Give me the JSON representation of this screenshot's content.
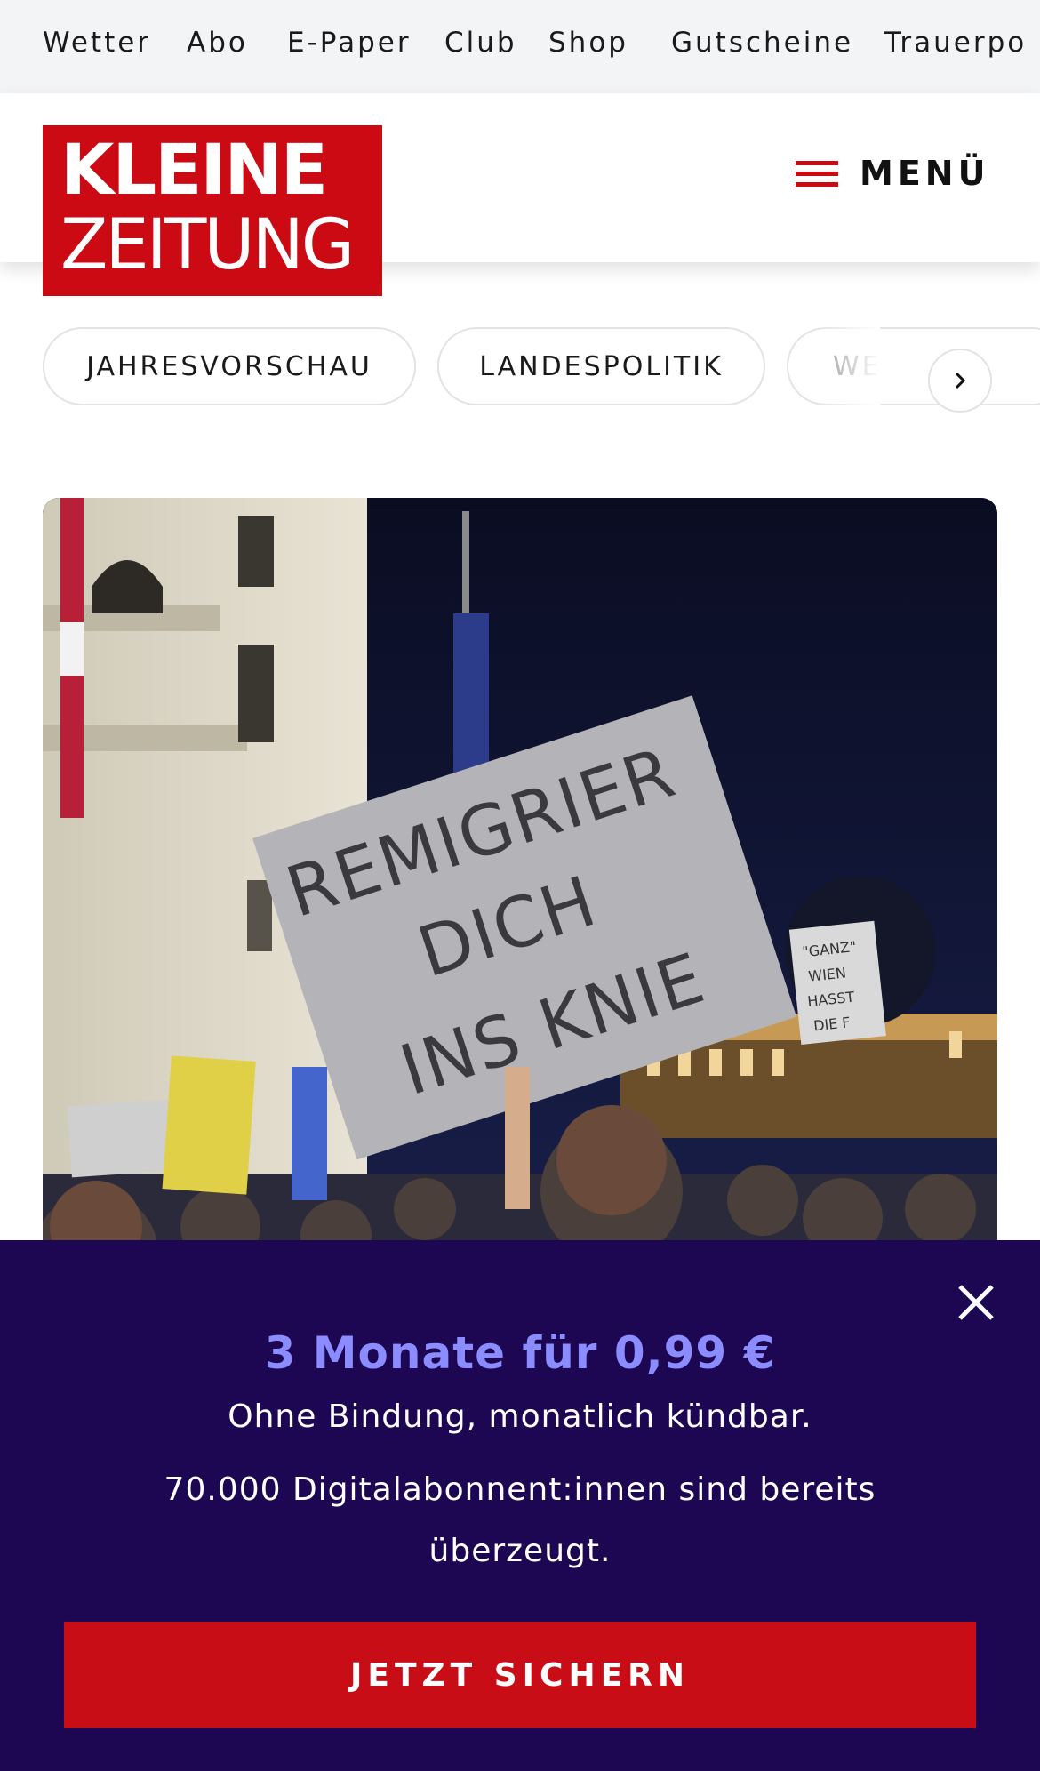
{
  "topbar": {
    "items": [
      {
        "label": "Wetter"
      },
      {
        "label": "Abo"
      },
      {
        "label": "E-Paper"
      },
      {
        "label": "Club"
      },
      {
        "label": "Shop"
      },
      {
        "label": "Gutscheine"
      },
      {
        "label": "Trauerpo"
      }
    ]
  },
  "header": {
    "logo": {
      "line1": "KLEINE",
      "line2": "ZEITUNG"
    },
    "menu_label": "MENÜ"
  },
  "chips": {
    "items": [
      {
        "label": "JAHRESVORSCHAU"
      },
      {
        "label": "LANDESPOLITIK"
      },
      {
        "label": "WE"
      }
    ],
    "next_icon": "chevron-right-icon"
  },
  "hero": {
    "sign_text": [
      "REMIGRIER",
      "DICH",
      "INS KNIE"
    ],
    "small_sign_text": [
      "\"GANZ\"",
      "WIEN",
      "HASST",
      "DIE F"
    ]
  },
  "promo": {
    "title": "3 Monate für 0,99 €",
    "subtitle": "Ohne Bindung, monatlich kündbar.",
    "text": "70.000 Digitalabonnent:innen sind bereits überzeugt.",
    "cta_label": "JETZT SICHERN",
    "close_icon": "close-icon"
  },
  "colors": {
    "brand_red": "#cc0a14",
    "promo_bg": "#1d0752",
    "promo_title": "#8a8cff"
  }
}
